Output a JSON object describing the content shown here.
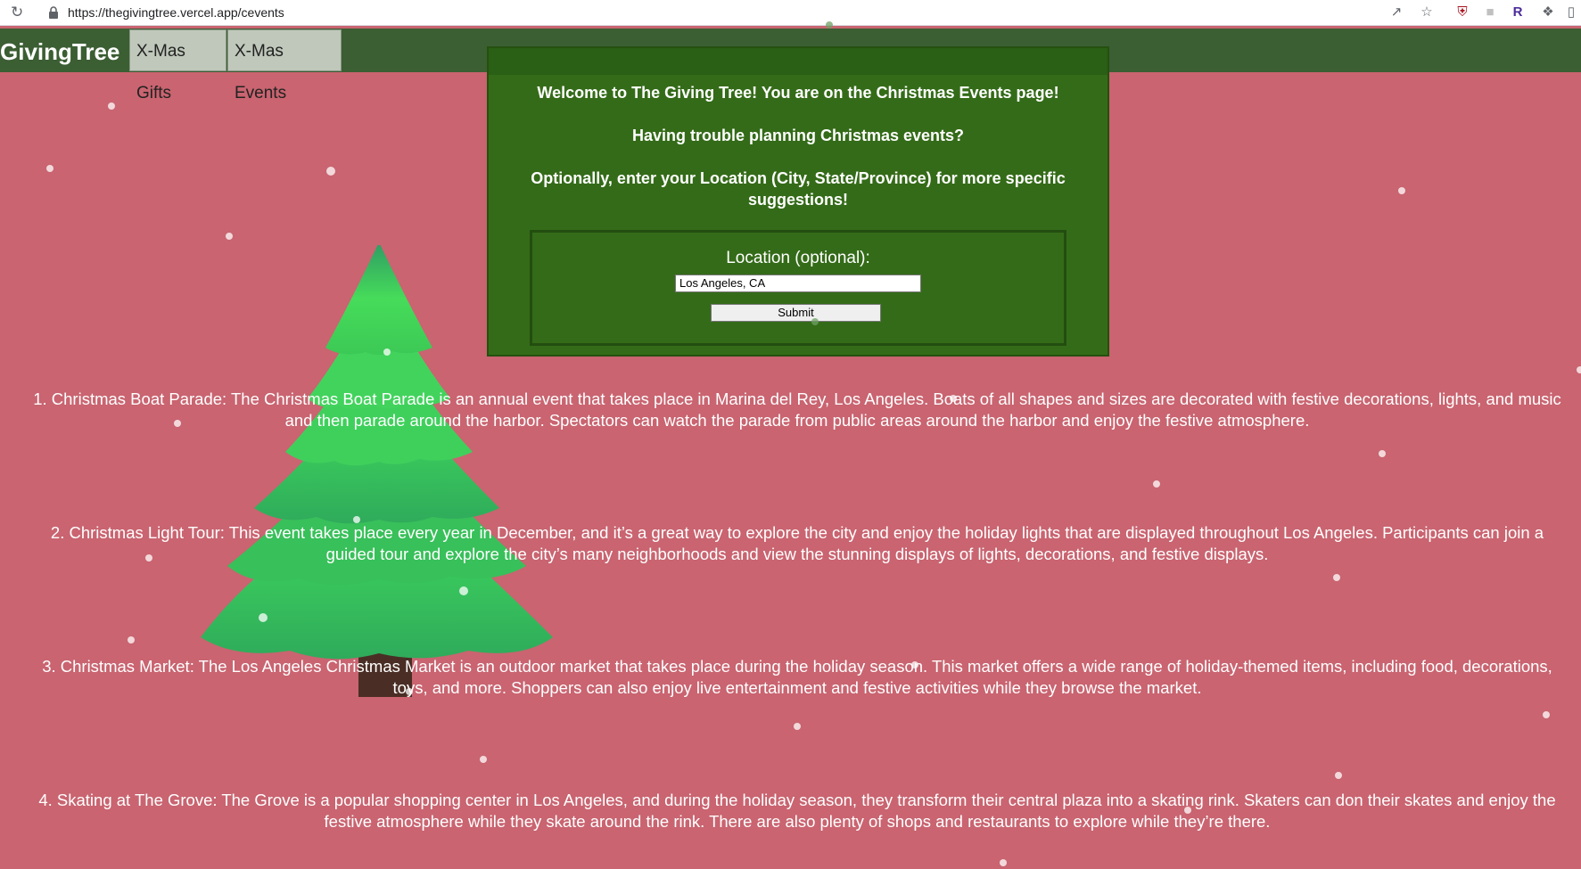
{
  "browser": {
    "url": "https://thegivingtree.vercel.app/cevents",
    "icons": [
      "reload-icon",
      "lock-icon",
      "share-icon",
      "star-icon",
      "ublock-icon",
      "extension-gray-icon",
      "r-extension-icon",
      "puzzle-icon",
      "sidebar-icon"
    ]
  },
  "nav": {
    "brand": "GivingTree",
    "links": [
      "X-Mas Gifts",
      "X-Mas Events"
    ]
  },
  "welcome": {
    "line1": "Welcome to The Giving Tree! You are on the Christmas Events page!",
    "line2": "Having trouble planning Christmas events?",
    "line3": "Optionally, enter your Location (City, State/Province) for more specific suggestions!"
  },
  "form": {
    "label": "Location (optional):",
    "location_value": "Los Angeles, CA",
    "submit_label": "Submit"
  },
  "events": [
    "1. Christmas Boat Parade: The Christmas Boat Parade is an annual event that takes place in Marina del Rey, Los Angeles. Boats of all shapes and sizes are decorated with festive decorations, lights, and music and then parade around the harbor. Spectators can watch the parade from public areas around the harbor and enjoy the festive atmosphere.",
    "2. Christmas Light Tour: This event takes place every year in December, and it’s a great way to explore the city and enjoy the holiday lights that are displayed throughout Los Angeles. Participants can join a guided tour and explore the city’s many neighborhoods and view the stunning displays of lights, decorations, and festive displays.",
    "3. Christmas Market: The Los Angeles Christmas Market is an outdoor market that takes place during the holiday season. This market offers a wide range of holiday-themed items, including food, decorations, toys, and more. Shoppers can also enjoy live entertainment and festive activities while they browse the market.",
    "4. Skating at The Grove: The Grove is a popular shopping center in Los Angeles, and during the holiday season, they transform their central plaza into a skating rink. Skaters can don their skates and enjoy the festive atmosphere while they skate around the rink. There are also plenty of shops and restaurants to explore while they’re there."
  ],
  "colors": {
    "background": "#c96470",
    "navbar": "#3b5e33",
    "panel": "#346b18",
    "tree_green": "#3ccf5c",
    "trunk": "#4a2e25"
  }
}
